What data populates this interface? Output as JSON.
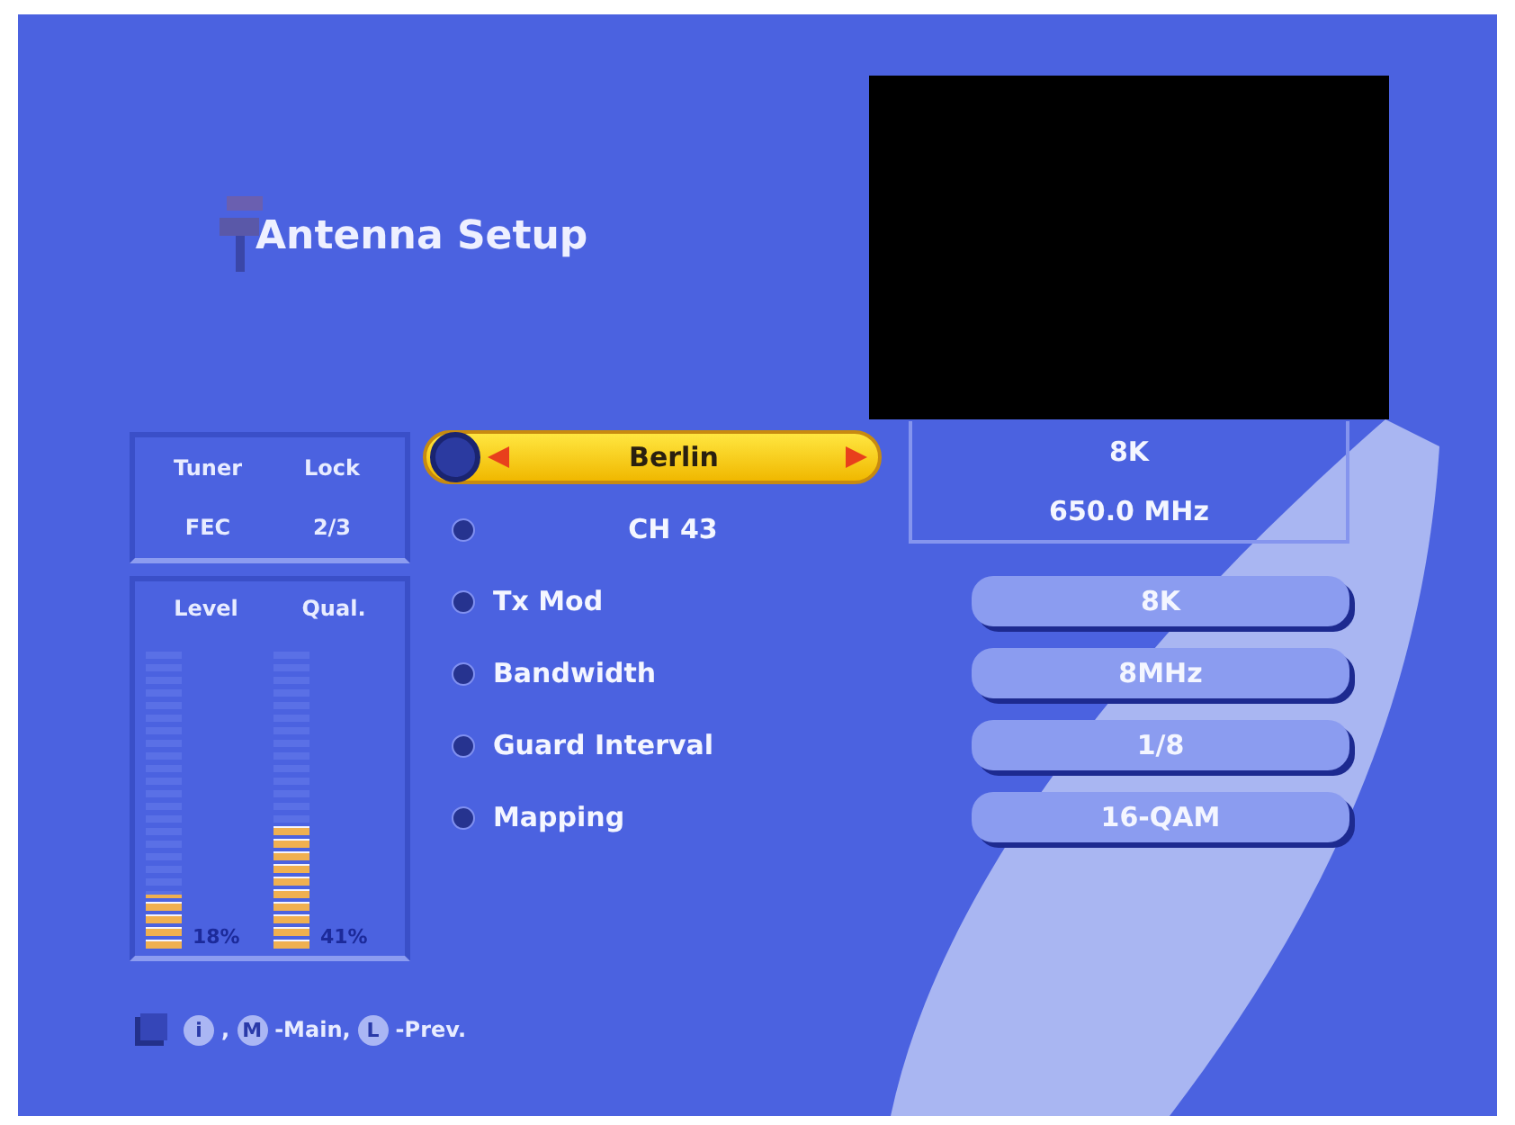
{
  "title": "Antenna Setup",
  "tuner": {
    "status_label": "Tuner",
    "status": "Lock",
    "fec_label": "FEC",
    "fec": "2/3"
  },
  "signal": [
    {
      "label": "Level",
      "level": 0.18,
      "reading": "18%"
    },
    {
      "label": "Qual.",
      "level": 0.41,
      "reading": "41%"
    }
  ],
  "menu": [
    {
      "kind": "selector",
      "label": "Berlin",
      "selected": true
    },
    {
      "kind": "channel",
      "label": "CH 43",
      "selected": false
    },
    {
      "kind": "setting",
      "label": "Tx Mod",
      "value": "8K",
      "selected": false
    },
    {
      "kind": "setting",
      "label": "Bandwidth",
      "value": "8MHz",
      "selected": false
    },
    {
      "kind": "setting",
      "label": "Guard Interval",
      "value": "1/8",
      "selected": false
    },
    {
      "kind": "setting",
      "label": "Mapping",
      "value": "16-QAM",
      "selected": false
    }
  ],
  "info": [
    "8K",
    "650.0 MHz"
  ],
  "footer": [
    {
      "kind": "key",
      "text": "i"
    },
    {
      "kind": "text",
      "text": ","
    },
    {
      "kind": "key",
      "text": "M"
    },
    {
      "kind": "text",
      "text": "-Main,"
    },
    {
      "kind": "key",
      "text": "L"
    },
    {
      "kind": "text",
      "text": "-Prev."
    }
  ]
}
